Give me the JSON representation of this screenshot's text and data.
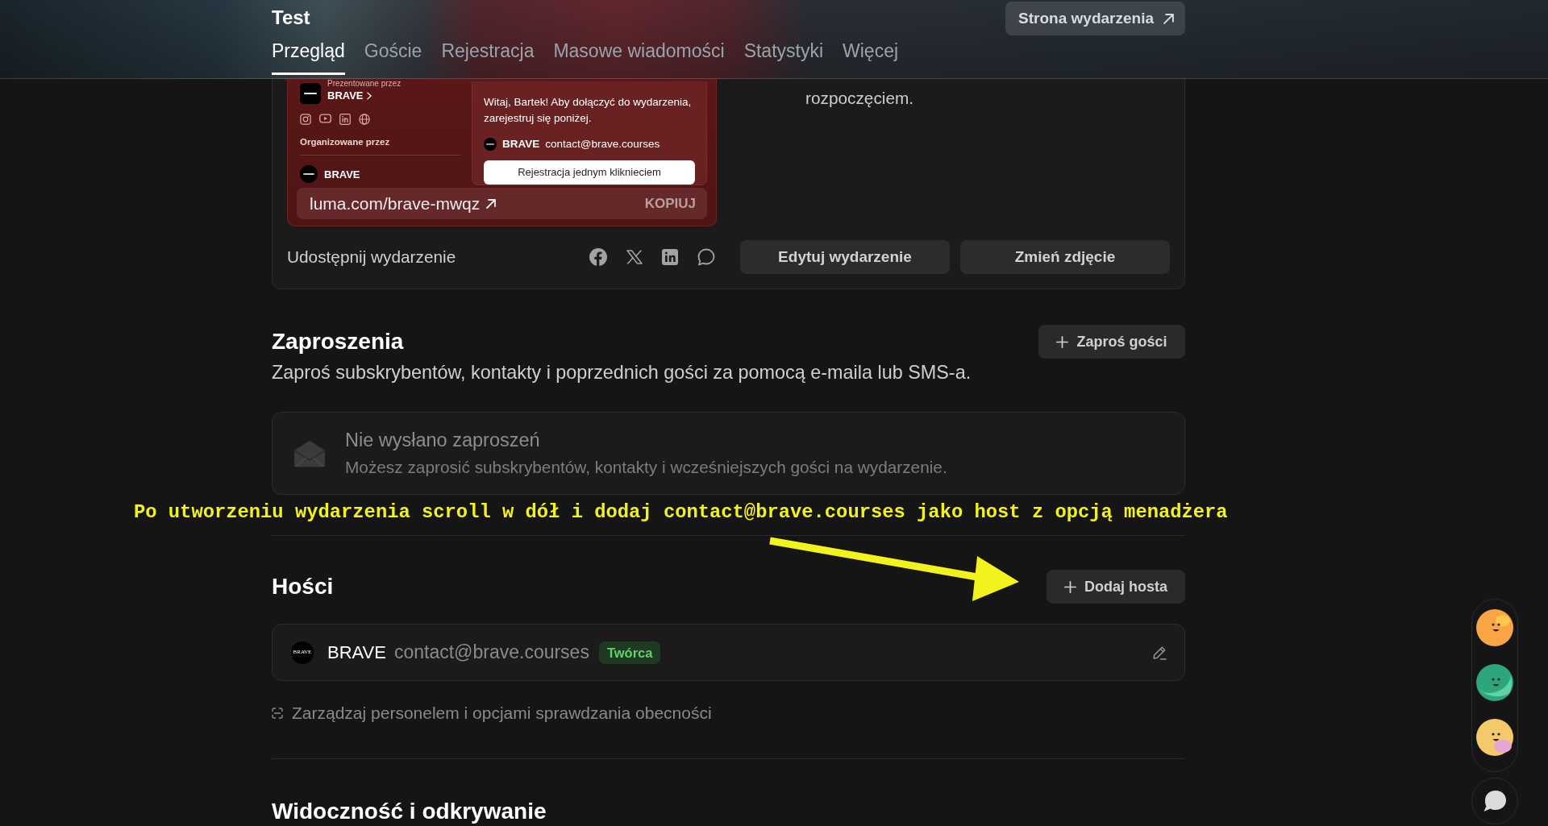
{
  "header": {
    "title": "Test",
    "event_page_button": "Strona wydarzenia",
    "tabs": [
      {
        "label": "Przegląd",
        "selected": true
      },
      {
        "label": "Goście",
        "selected": false
      },
      {
        "label": "Rejestracja",
        "selected": false
      },
      {
        "label": "Masowe wiadomości",
        "selected": false
      },
      {
        "label": "Statystyki",
        "selected": false
      },
      {
        "label": "Więcej",
        "selected": false
      }
    ]
  },
  "event_card": {
    "preview": {
      "presented_by_label": "Prezentowane przez",
      "presenter": "BRAVE",
      "organized_by_label": "Organizowane przez",
      "organizer": "BRAVE",
      "greeting": "Witaj, Bartek! Aby dołączyć do wydarzenia, zarejestruj się poniżej.",
      "host_name": "BRAVE",
      "host_email": "contact@brave.courses",
      "register_button": "Rejestracja jednym kliknieciem"
    },
    "link": {
      "url": "luma.com/brave-mwqz",
      "copy_button": "KOPIUJ"
    },
    "side_text": "rozpoczęciem.",
    "share_label": "Udostępnij wydarzenie",
    "buttons": [
      "Edytuj wydarzenie",
      "Zmień zdjęcie"
    ]
  },
  "invitations": {
    "title": "Zaproszenia",
    "button": "Zaproś gości",
    "description": "Zaproś subskrybentów, kontakty i poprzednich gości za pomocą e-maila lub SMS-a.",
    "empty_state": {
      "title": "Nie wysłano zaproszeń",
      "text": "Możesz zaprosić subskrybentów, kontakty i wcześniejszych gości na wydarzenie."
    }
  },
  "annotation": {
    "text": "Po utworzeniu wydarzenia scroll w dół i dodaj contact@brave.courses jako host z opcją menadżera"
  },
  "hosts": {
    "title": "Hości",
    "button": "Dodaj hosta",
    "items": [
      {
        "logo": "BRAVE",
        "name": "BRAVE",
        "email": "contact@brave.courses",
        "role": "Twórca"
      }
    ],
    "manage_link": "Zarządzaj personelem i opcjami sprawdzania obecności"
  },
  "visibility": {
    "title": "Widoczność i odkrywanie"
  },
  "floating": {
    "avatars": [
      {
        "color": "#f9a545"
      },
      {
        "color": "#2ea57a"
      },
      {
        "color": "#f4c96b"
      }
    ]
  }
}
